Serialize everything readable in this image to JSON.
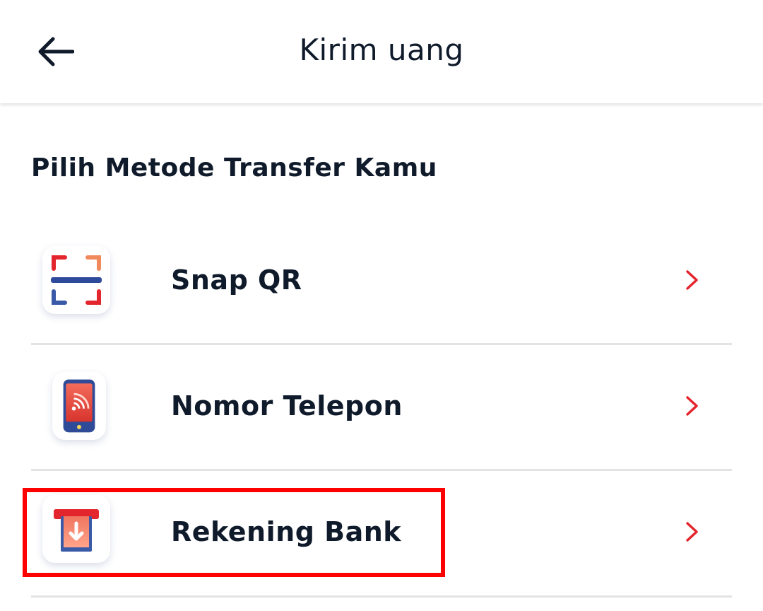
{
  "header": {
    "title": "Kirim uang",
    "back_icon": "arrow-left-icon"
  },
  "section": {
    "title": "Pilih Metode Transfer Kamu"
  },
  "methods": [
    {
      "label": "Snap QR",
      "icon": "qr-scan-icon"
    },
    {
      "label": "Nomor Telepon",
      "icon": "phone-icon"
    },
    {
      "label": "Rekening Bank",
      "icon": "bank-transfer-icon"
    }
  ],
  "colors": {
    "accent": "#e3262e",
    "highlight_border": "#ff0000",
    "text": "#0f1a2a",
    "divider": "#e3e3e3"
  }
}
